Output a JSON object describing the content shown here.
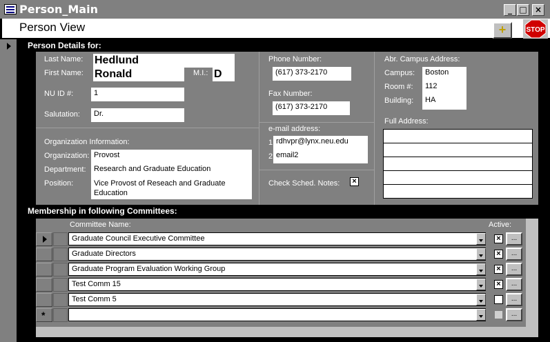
{
  "window": {
    "title": "Person_Main"
  },
  "header": {
    "title": "Person View",
    "add_icon": "plus-icon",
    "stop_label": "STOP"
  },
  "details": {
    "section_title": "Person Details for:",
    "last_name_label": "Last Name:",
    "last_name": "Hedlund",
    "first_name_label": "First Name:",
    "first_name": "Ronald",
    "mi_label": "M.I.:",
    "mi": "D",
    "nuid_label": "NU ID #:",
    "nuid": "1",
    "salutation_label": "Salutation:",
    "salutation": "Dr.",
    "phone_label": "Phone Number:",
    "phone": "(617)  373-2170",
    "fax_label": "Fax Number:",
    "fax": "(617)  373-2170",
    "campus_header": "Abr. Campus Address:",
    "campus_label": "Campus:",
    "campus": "Boston",
    "room_label": "Room #:",
    "room": "112",
    "building_label": "Building:",
    "building": "HA",
    "full_address_label": "Full Address:",
    "org_header": "Organization Information:",
    "organization_label": "Organization:",
    "organization": "Provost",
    "department_label": "Department:",
    "department": "Research and Graduate Education",
    "position_label": "Position:",
    "position": "Vice Provost of Reseach and Graduate Education",
    "email_header": "e-mail address:",
    "email1_num": "1",
    "email1": "rdhvpr@lynx.neu.edu",
    "email2_num": "2",
    "email2": "email2",
    "check_sched_label": "Check Sched. Notes:",
    "check_sched": true
  },
  "committees": {
    "section_title": "Membership in following Committees:",
    "col_name": "Committee Name:",
    "col_active": "Active:",
    "new_row_marker": "*",
    "button_label": "...",
    "rows": [
      {
        "name": "Graduate Council Executive Committee",
        "active": true
      },
      {
        "name": "Graduate Directors",
        "active": true
      },
      {
        "name": "Graduate Program Evaluation Working Group",
        "active": true
      },
      {
        "name": "Test Comm 15",
        "active": true
      },
      {
        "name": "Test Comm 5",
        "active": false
      }
    ]
  }
}
